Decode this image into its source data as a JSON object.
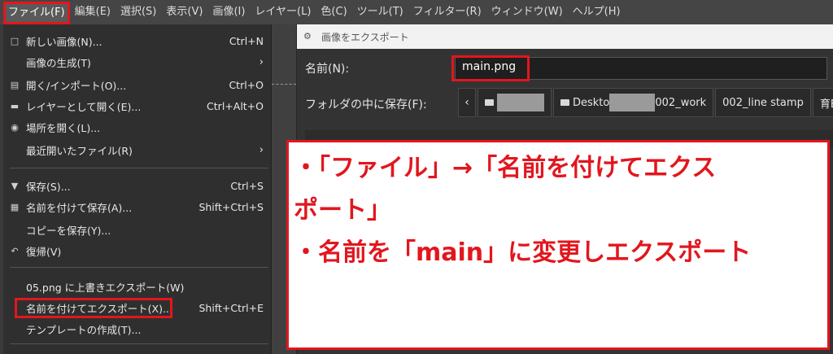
{
  "menubar": {
    "items": [
      "ファイル(F)",
      "編集(E)",
      "選択(S)",
      "表示(V)",
      "画像(I)",
      "レイヤー(L)",
      "色(C)",
      "ツール(T)",
      "フィルター(R)",
      "ウィンドウ(W)",
      "ヘルプ(H)"
    ]
  },
  "file_menu": {
    "items": [
      {
        "label": "新しい画像(N)...",
        "shortcut": "Ctrl+N",
        "icon": "new-image-icon"
      },
      {
        "label": "画像の生成(T)",
        "shortcut": "",
        "icon": "",
        "submenu": true
      },
      {
        "label": "開く/インポート(O)...",
        "shortcut": "Ctrl+O",
        "icon": "open-icon"
      },
      {
        "label": "レイヤーとして開く(E)...",
        "shortcut": "Ctrl+Alt+O",
        "icon": "open-as-layer-icon"
      },
      {
        "label": "場所を開く(L)...",
        "shortcut": "",
        "icon": "globe-icon"
      },
      {
        "label": "最近開いたファイル(R)",
        "shortcut": "",
        "icon": "",
        "submenu": true
      },
      {
        "label": "保存(S)...",
        "shortcut": "Ctrl+S",
        "icon": "save-icon"
      },
      {
        "label": "名前を付けて保存(A)...",
        "shortcut": "Shift+Ctrl+S",
        "icon": "save-as-icon"
      },
      {
        "label": "コピーを保存(Y)...",
        "shortcut": "",
        "icon": ""
      },
      {
        "label": "復帰(V)",
        "shortcut": "",
        "icon": "revert-icon"
      },
      {
        "label": "05.png に上書きエクスポート(W)",
        "shortcut": "",
        "icon": ""
      },
      {
        "label": "名前を付けてエクスポート(X)...",
        "shortcut": "Shift+Ctrl+E",
        "icon": ""
      },
      {
        "label": "テンプレートの作成(T)...",
        "shortcut": "",
        "icon": ""
      }
    ]
  },
  "dialog": {
    "title": "画像をエクスポート",
    "name_label": "名前(N):",
    "name_value": "main.png",
    "folder_label": "フォルダの中に保存(F):",
    "crumbs": [
      "Deskto",
      "002_work",
      "002_line stamp",
      "育E"
    ]
  },
  "annotation": {
    "line1": "・「ファイル」→「名前を付けてエクスポート」",
    "line1a": "・「ファイル」→「名前を付けてエクス",
    "line1b": "ポート」",
    "line2": "・名前を「main」に変更しエクスポート"
  },
  "colors": {
    "highlight": "#e2161e",
    "menu_bg": "#2f2f2f",
    "dialog_bg": "#333333"
  }
}
